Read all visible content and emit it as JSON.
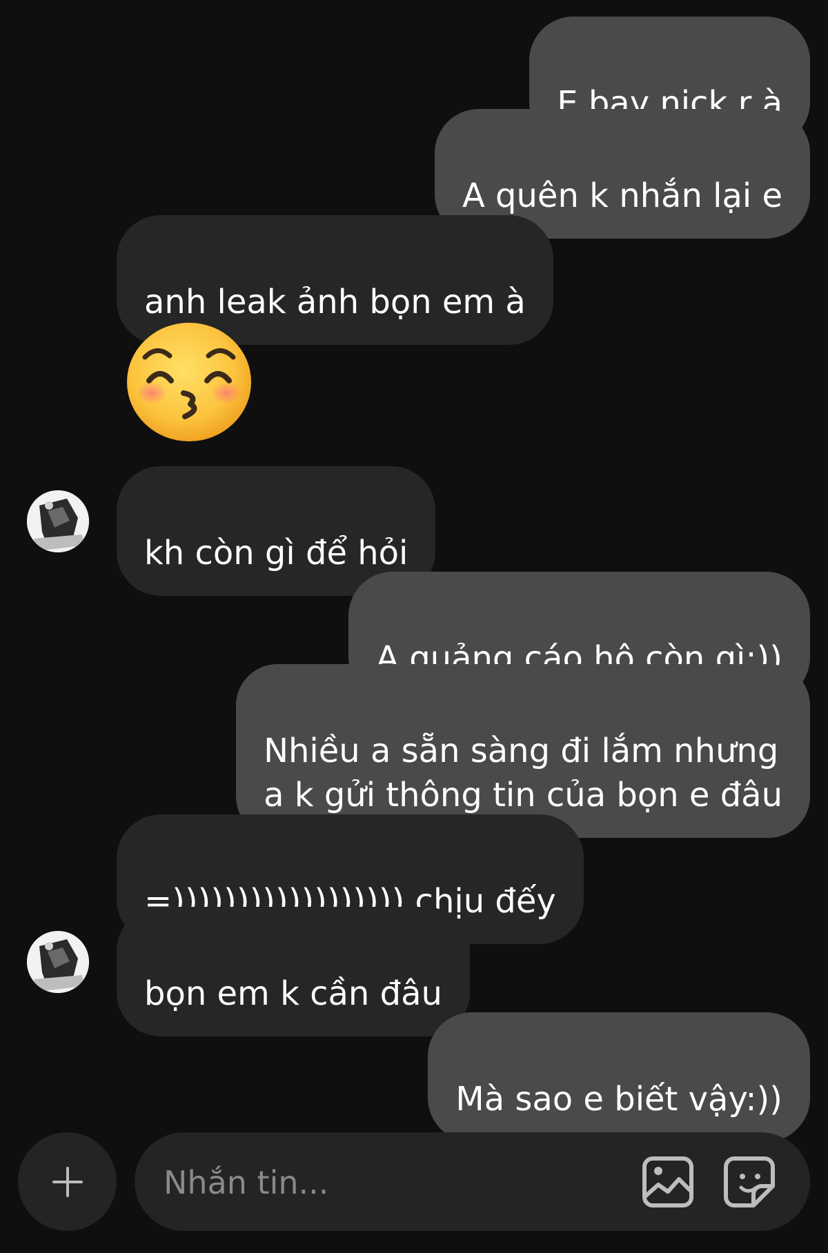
{
  "messages": [
    {
      "side": "sent",
      "text": "E bay nick r à"
    },
    {
      "side": "sent",
      "text": "A quên k nhắn lại e"
    },
    {
      "side": "received",
      "text": "anh leak ảnh bọn em à"
    },
    {
      "side": "received",
      "type": "emoji",
      "icon": "kissing-face-with-smiling-eyes-icon"
    },
    {
      "side": "received",
      "text": "kh còn gì để hỏi"
    },
    {
      "side": "sent",
      "text": "A quảng cáo hộ còn gì:))"
    },
    {
      "side": "sent",
      "text": "Nhiều a sẵn sàng đi lắm nhưng\na k gửi thông tin của bọn e đâu"
    },
    {
      "side": "received",
      "text": "=)))))))))))))))))) chịu đếy"
    },
    {
      "side": "received",
      "text": "bọn em k cần đâu"
    },
    {
      "side": "sent",
      "text": "Mà sao e biết vậy:))"
    }
  ],
  "composer": {
    "placeholder": "Nhắn tin...",
    "icons": [
      "plus-icon",
      "image-icon",
      "sticker-icon"
    ]
  },
  "colors": {
    "background": "#0f0f0f",
    "sent_bubble": "#4a4a4a",
    "received_bubble": "#262626",
    "composer": "#242424"
  }
}
